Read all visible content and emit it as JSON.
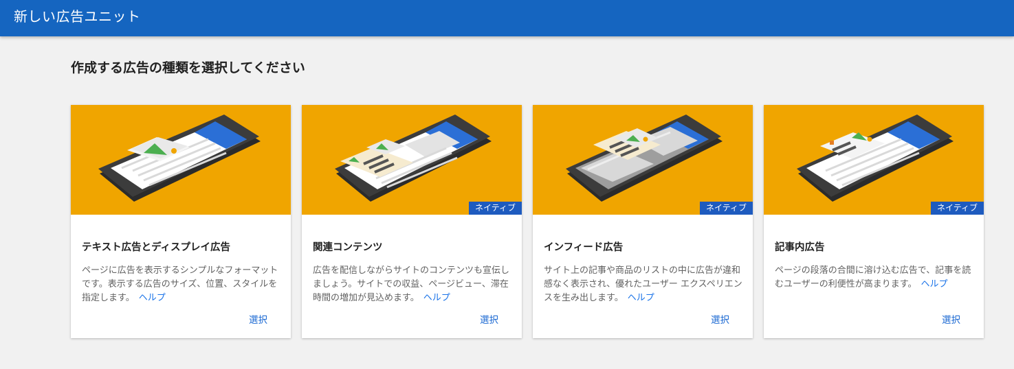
{
  "header": {
    "title": "新しい広告ユニット"
  },
  "page": {
    "heading": "作成する広告の種類を選択してください"
  },
  "colors": {
    "header_bg": "#1565c0",
    "card_hero_bg": "#f0a500",
    "badge_bg": "#1e5bbf",
    "link": "#1a73e8"
  },
  "cards": [
    {
      "title": "テキスト広告とディスプレイ広告",
      "badge": "",
      "description": "ページに広告を表示するシンプルなフォーマットです。表示する広告のサイズ、位置、スタイルを指定します。",
      "help_label": "ヘルプ",
      "select_label": "選択",
      "illustration": "phone-display-ad-illustration"
    },
    {
      "title": "関連コンテンツ",
      "badge": "ネイティブ",
      "description": "広告を配信しながらサイトのコンテンツも宣伝しましょう。サイトでの収益、ページビュー、滞在時間の増加が見込めます。",
      "help_label": "ヘルプ",
      "select_label": "選択",
      "illustration": "phone-related-content-illustration"
    },
    {
      "title": "インフィード広告",
      "badge": "ネイティブ",
      "description": "サイト上の記事や商品のリストの中に広告が違和感なく表示され、優れたユーザー エクスペリエンスを生み出します。",
      "help_label": "ヘルプ",
      "select_label": "選択",
      "illustration": "phone-in-feed-illustration"
    },
    {
      "title": "記事内広告",
      "badge": "ネイティブ",
      "description": "ページの段落の合間に溶け込む広告で、記事を読むユーザーの利便性が高まります。",
      "help_label": "ヘルプ",
      "select_label": "選択",
      "illustration": "phone-in-article-illustration"
    }
  ]
}
